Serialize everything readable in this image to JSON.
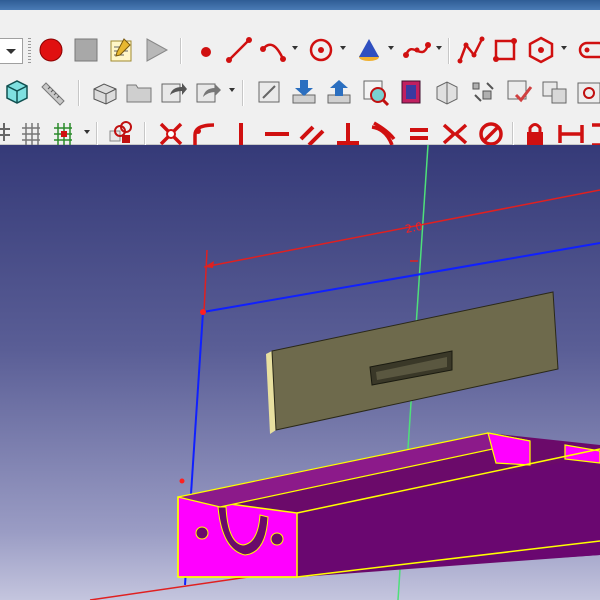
{
  "app": {
    "accent": "#cc1f1f"
  },
  "toolbar_rows": [
    {
      "name": "macro-sketch-toolbar",
      "icons": [
        "workbench-combo-arrow",
        "record-macro-icon",
        "stop-macro-icon",
        "edit-macro-icon",
        "execute-macro-icon",
        "point-icon",
        "line-icon",
        "arc-icon",
        "circle-icon",
        "conic-icon",
        "bspline-icon",
        "polyline-icon",
        "rectangle-icon",
        "polygon-icon",
        "slot-icon"
      ]
    },
    {
      "name": "view-part-toolbar",
      "icons": [
        "isometric-view-icon",
        "measure-icon",
        "part-icon",
        "folder-icon",
        "export-icon",
        "share-icon",
        "new-sketch-icon",
        "download-icon",
        "upload-icon",
        "view-sketch-icon",
        "view-section-icon",
        "map-sketch-icon",
        "reorient-icon",
        "validate-sketch-icon",
        "merge-sketches-icon"
      ]
    },
    {
      "name": "constraint-toolbar",
      "icons": [
        "snap-icon",
        "grid-icon",
        "construction-geometry-icon",
        "toggle-constraints-icon",
        "coincident-constraint-icon",
        "point-on-object-icon",
        "vertical-constraint-icon",
        "horizontal-constraint-icon",
        "parallel-constraint-icon",
        "perpendicular-constraint-icon",
        "tangent-constraint-icon",
        "equal-constraint-icon",
        "symmetric-constraint-icon",
        "block-constraint-icon",
        "lock-constraint-icon",
        "horizontal-distance-icon"
      ]
    }
  ],
  "viewport": {
    "dimension_label": "2.0",
    "colors": {
      "face_selected": "#ff00ff",
      "body": "#7a0a78",
      "edge_highlight": "#ffff00",
      "lid": "#6e6a4c"
    }
  }
}
